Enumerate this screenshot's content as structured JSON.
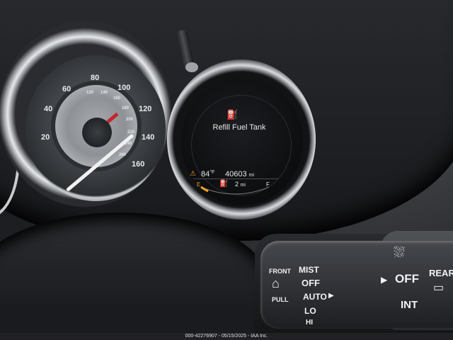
{
  "photo": {
    "speedometer": {
      "major_ticks": [
        "20",
        "40",
        "60",
        "80",
        "100",
        "120",
        "140",
        "160"
      ],
      "minor_ticks": [
        "120",
        "140",
        "160",
        "180",
        "200",
        "220",
        "240",
        "260"
      ]
    },
    "display": {
      "alert_message": "Refill Fuel Tank",
      "outside_temp": "84",
      "outside_temp_unit": "°F",
      "odometer": "40603",
      "odometer_unit": "mi",
      "range_value": "2",
      "range_unit": "mi",
      "fuel_gauge_empty": "E",
      "fuel_gauge_full": "F",
      "icons": [
        "fuel-pump-icon",
        "warning-triangle-icon"
      ],
      "accent_color": "#f0a020"
    },
    "wiper_stalk": {
      "labels": [
        "FRONT",
        "MIST",
        "OFF",
        "AUTO",
        "LO",
        "HI",
        "PULL",
        "OFF",
        "INT",
        "REAR"
      ]
    }
  },
  "caption": "000-42276907 - 05/15/2025 - IAA Inc."
}
